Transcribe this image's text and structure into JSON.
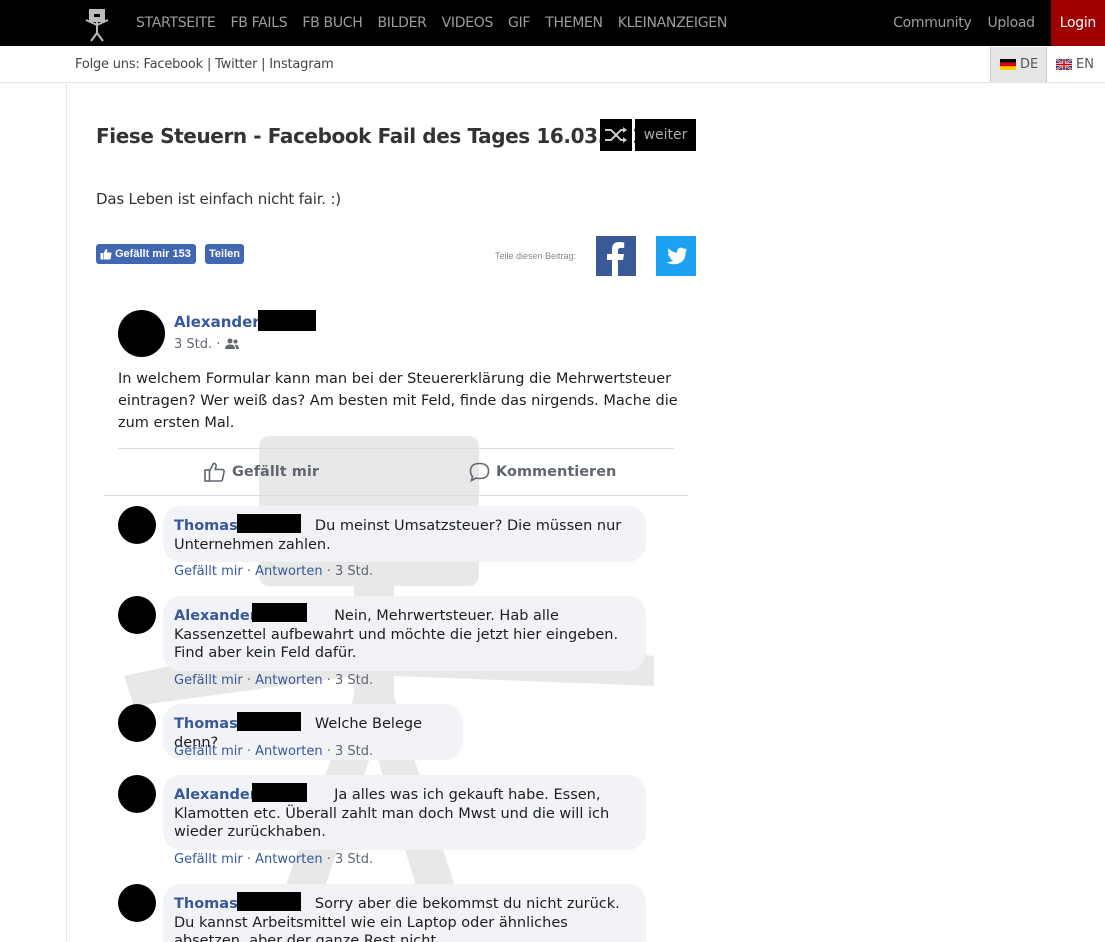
{
  "nav": {
    "items": [
      "STARTSEITE",
      "FB FAILS",
      "FB BUCH",
      "BILDER",
      "VIDEOS",
      "GIF",
      "THEMEN",
      "KLEINANZEIGEN"
    ],
    "community": "Community",
    "upload": "Upload",
    "login": "Login"
  },
  "subbar": {
    "follow": "Folge uns: Facebook | Twitter | Instagram",
    "lang_de": "DE",
    "lang_en": "EN"
  },
  "article": {
    "title": "Fiese Steuern - Facebook Fail des Tages 16.03.2019",
    "next_label": "weiter",
    "teaser": "Das Leben ist einfach nicht fair. :)",
    "like_label": "Gefällt mir 153",
    "share_label": "Teilen",
    "share_post_label": "Teile diesen Beitrag:"
  },
  "post": {
    "author": "Alexander",
    "meta": "3 Std. ·",
    "text": "In welchem Formular kann man bei der Steuererklärung die Mehrwertsteuer eintragen? Wer weiß das? Am besten mit Feld, finde das nirgends. Mache die zum ersten Mal.",
    "like_action": "Gefällt mir",
    "comment_action": "Kommentieren"
  },
  "comments": [
    {
      "name": "Thomas",
      "text": "Du meinst Umsatzsteuer? Die müssen nur Unternehmen zahlen."
    },
    {
      "name": "Alexander",
      "text": "Nein, Mehrwertsteuer. Hab alle Kassenzettel aufbewahrt und möchte die jetzt hier eingeben. Find aber kein Feld dafür."
    },
    {
      "name": "Thomas",
      "text": "Welche Belege denn?"
    },
    {
      "name": "Alexander",
      "text": "Ja alles was ich gekauft habe. Essen, Klamotten etc. Überall zahlt man doch Mwst und die will ich wieder zurückhaben."
    },
    {
      "name": "Thomas",
      "text": "Sorry aber die bekommst du nicht zurück. Du kannst Arbeitsmittel wie ein Laptop oder ähnliches absetzen, aber der ganze Rest nicht."
    }
  ],
  "comment_actions": {
    "like": "Gefällt mir",
    "dot": " · ",
    "reply": "Antworten",
    "time": " · 3 Std."
  },
  "colors": {
    "topbar": "#000000",
    "login_bg": "#a00000",
    "fb_blue": "#4267b2",
    "name_blue": "#385898",
    "twitter": "#1da1f2"
  },
  "icons": [
    "logo-icon",
    "shuffle-icon",
    "thumbs-up-icon",
    "facebook-icon",
    "twitter-icon",
    "friends-icon",
    "comment-icon"
  ]
}
